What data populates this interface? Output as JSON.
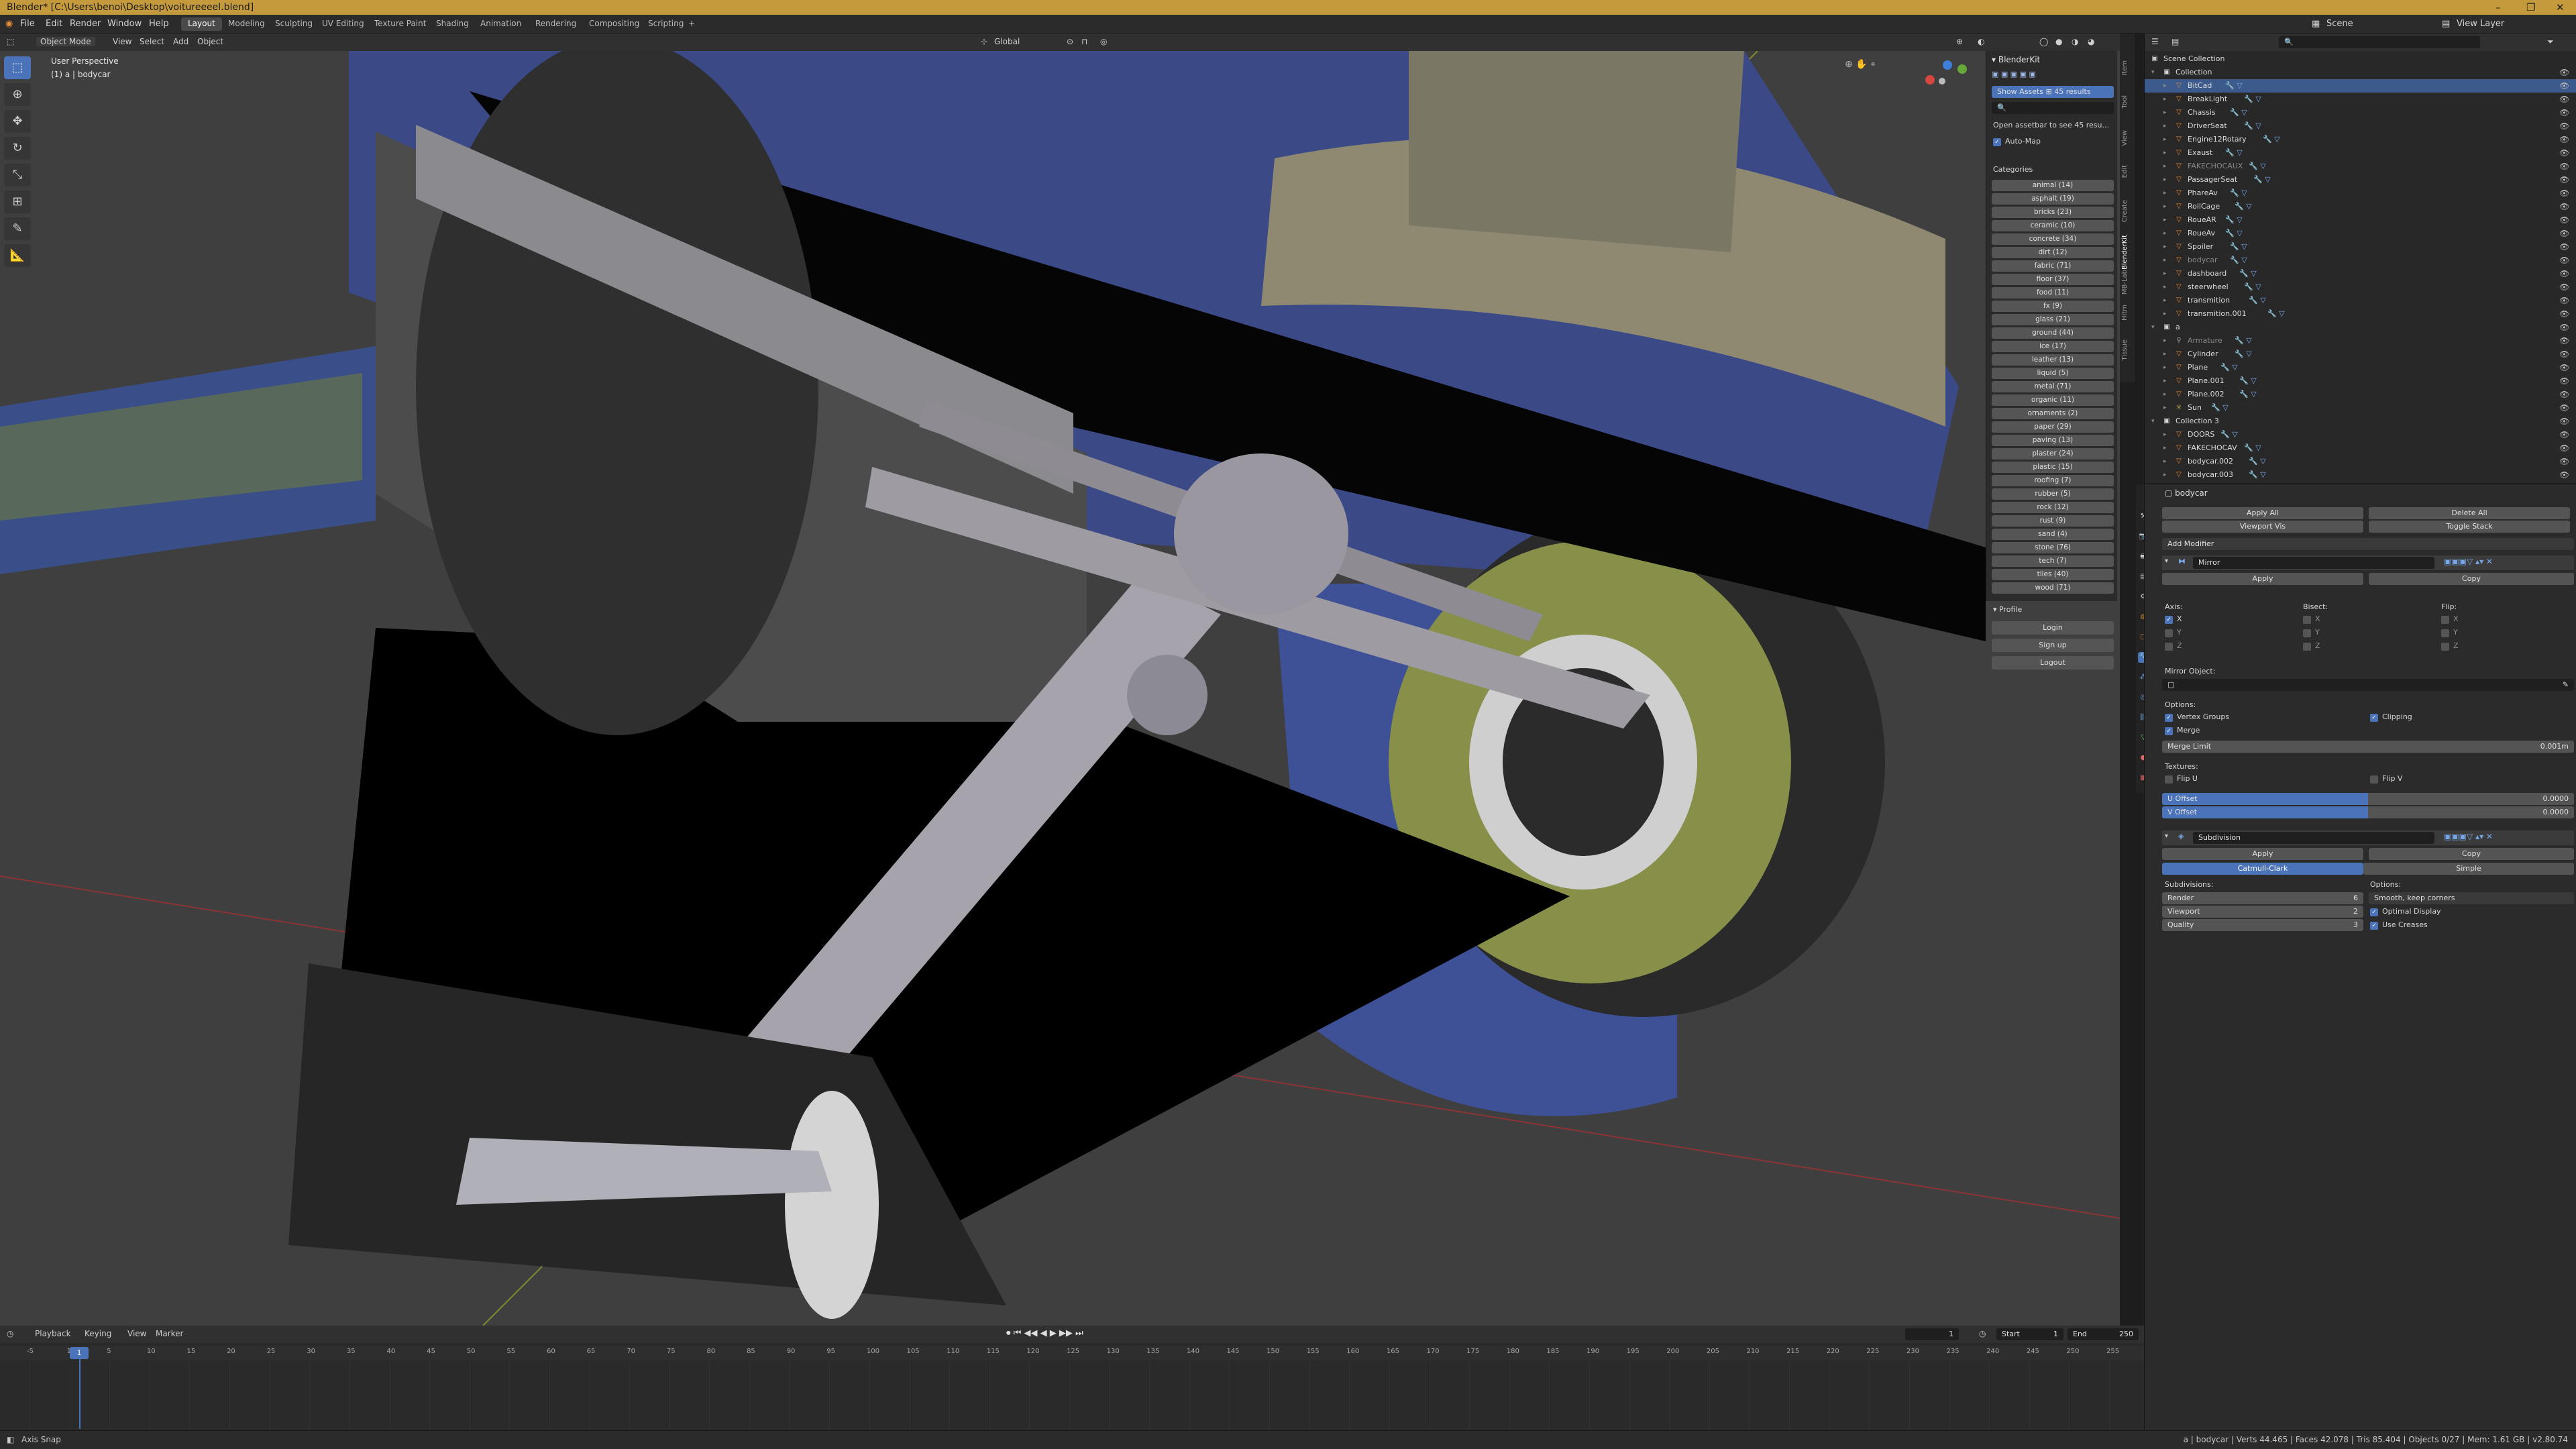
{
  "window": {
    "title": "Blender* [C:\\Users\\benoi\\Desktop\\voitureeeel.blend]",
    "controls": [
      "–",
      "❐",
      "✕"
    ]
  },
  "menu": [
    "File",
    "Edit",
    "Render",
    "Window",
    "Help"
  ],
  "workspaces": {
    "active": "Layout",
    "tabs": [
      "Layout",
      "Modeling",
      "Sculpting",
      "UV Editing",
      "Texture Paint",
      "Shading",
      "Animation",
      "Rendering",
      "Compositing",
      "Scripting",
      "+"
    ]
  },
  "scene": {
    "label": "Scene",
    "view_layer": "View Layer"
  },
  "viewport_header": {
    "mode": "Object Mode",
    "menus": [
      "View",
      "Select",
      "Add",
      "Object"
    ],
    "orientation": "Global"
  },
  "viewport": {
    "perspective": "User Perspective",
    "object_info": "(1) a | bodycar"
  },
  "blenderkit": {
    "title": "BlenderKit",
    "show_assets": "Show Assets",
    "results": "45 results",
    "open_hint": "Open assetbar to see 45 resu...",
    "auto_map": "Auto-Map",
    "categories_title": "Categories",
    "categories": [
      "animal (14)",
      "asphalt (19)",
      "bricks (23)",
      "ceramic (10)",
      "concrete (34)",
      "dirt (12)",
      "fabric (71)",
      "floor (37)",
      "food (11)",
      "fx (9)",
      "glass (21)",
      "ground (44)",
      "ice (17)",
      "leather (13)",
      "liquid (5)",
      "metal (71)",
      "organic (11)",
      "ornaments (2)",
      "paper (29)",
      "paving (13)",
      "plaster (24)",
      "plastic (15)",
      "roofing (7)",
      "rubber (5)",
      "rock (12)",
      "rust (9)",
      "sand (4)",
      "stone (76)",
      "tech (7)",
      "tiles (40)",
      "wood (71)"
    ],
    "profile_title": "Profile",
    "profile_buttons": [
      "Login",
      "Sign up",
      "Logout"
    ]
  },
  "side_tabs": [
    "Item",
    "Tool",
    "View",
    "Edit",
    "Create",
    "BlenderKit",
    "MB-Lab",
    "Hitm",
    "Tissue"
  ],
  "outliner": {
    "root": "Scene Collection",
    "rows": [
      {
        "indent": 1,
        "name": "Collection",
        "kind": "collection"
      },
      {
        "indent": 2,
        "name": "BitCad",
        "kind": "object",
        "selected": true
      },
      {
        "indent": 2,
        "name": "BreakLight",
        "kind": "object"
      },
      {
        "indent": 2,
        "name": "Chassis",
        "kind": "object"
      },
      {
        "indent": 2,
        "name": "DriverSeat",
        "kind": "object"
      },
      {
        "indent": 2,
        "name": "Engine12Rotary",
        "kind": "object"
      },
      {
        "indent": 2,
        "name": "Exaust",
        "kind": "object"
      },
      {
        "indent": 2,
        "name": "FAKECHOCAUX",
        "kind": "object",
        "dim": true
      },
      {
        "indent": 2,
        "name": "PassagerSeat",
        "kind": "object"
      },
      {
        "indent": 2,
        "name": "PhareAv",
        "kind": "object"
      },
      {
        "indent": 2,
        "name": "RollCage",
        "kind": "object"
      },
      {
        "indent": 2,
        "name": "RoueAR",
        "kind": "object"
      },
      {
        "indent": 2,
        "name": "RoueAv",
        "kind": "object"
      },
      {
        "indent": 2,
        "name": "Spoiler",
        "kind": "object"
      },
      {
        "indent": 2,
        "name": "bodycar",
        "kind": "object",
        "dim": true
      },
      {
        "indent": 2,
        "name": "dashboard",
        "kind": "object"
      },
      {
        "indent": 2,
        "name": "steerwheel",
        "kind": "object"
      },
      {
        "indent": 2,
        "name": "transmition",
        "kind": "object"
      },
      {
        "indent": 2,
        "name": "transmition.001",
        "kind": "object"
      },
      {
        "indent": 1,
        "name": "a",
        "kind": "collection"
      },
      {
        "indent": 2,
        "name": "Armature",
        "kind": "armature",
        "dim": true
      },
      {
        "indent": 2,
        "name": "Cylinder",
        "kind": "object"
      },
      {
        "indent": 2,
        "name": "Plane",
        "kind": "object"
      },
      {
        "indent": 2,
        "name": "Plane.001",
        "kind": "object"
      },
      {
        "indent": 2,
        "name": "Plane.002",
        "kind": "object"
      },
      {
        "indent": 2,
        "name": "Sun",
        "kind": "light"
      },
      {
        "indent": 1,
        "name": "Collection 3",
        "kind": "collection"
      },
      {
        "indent": 2,
        "name": "DOORS",
        "kind": "object"
      },
      {
        "indent": 2,
        "name": "FAKECHOCAV",
        "kind": "object"
      },
      {
        "indent": 2,
        "name": "bodycar.002",
        "kind": "object"
      },
      {
        "indent": 2,
        "name": "bodycar.003",
        "kind": "object"
      }
    ]
  },
  "properties": {
    "object": "bodycar",
    "apply_all": "Apply All",
    "delete_all": "Delete All",
    "viewport_vis": "Viewport Vis",
    "toggle_stack": "Toggle Stack",
    "add_modifier": "Add Modifier",
    "mirror": {
      "name": "Mirror",
      "apply": "Apply",
      "copy": "Copy",
      "axis_label": "Axis:",
      "bisect_label": "Bisect:",
      "flip_label": "Flip:",
      "axes": [
        "X",
        "Y",
        "Z"
      ],
      "mirror_object": "Mirror Object:",
      "options_label": "Options:",
      "vertex_groups": "Vertex Groups",
      "clipping": "Clipping",
      "merge": "Merge",
      "merge_limit_label": "Merge Limit",
      "merge_limit_value": "0.001m",
      "textures_label": "Textures:",
      "flip_u": "Flip U",
      "flip_v": "Flip V",
      "u_offset_label": "U Offset",
      "u_offset_value": "0.0000",
      "v_offset_label": "V Offset",
      "v_offset_value": "0.0000"
    },
    "subdivision": {
      "name": "Subdivision",
      "apply": "Apply",
      "copy": "Copy",
      "catmull": "Catmull-Clark",
      "simple": "Simple",
      "subdivisions_label": "Subdivisions:",
      "options_label": "Options:",
      "render_label": "Render",
      "render_value": "6",
      "viewport_label": "Viewport",
      "viewport_value": "2",
      "quality_label": "Quality",
      "quality_value": "3",
      "smooth": "Smooth, keep corners",
      "optimal_display": "Optimal Display",
      "use_creases": "Use Creases"
    }
  },
  "timeline": {
    "menus": [
      "Playback",
      "Keying",
      "View",
      "Marker"
    ],
    "current_frame": "1",
    "start_label": "Start",
    "start_value": "1",
    "end_label": "End",
    "end_value": "250",
    "ticks": [
      "-5",
      "1",
      "5",
      "10",
      "15",
      "20",
      "25",
      "30",
      "35",
      "40",
      "45",
      "50",
      "55",
      "60",
      "65",
      "70",
      "75",
      "80",
      "85",
      "90",
      "95",
      "100",
      "105",
      "110",
      "115",
      "120",
      "125",
      "130",
      "135",
      "140",
      "145",
      "150",
      "155",
      "160",
      "165",
      "170",
      "175",
      "180",
      "185",
      "190",
      "195",
      "200",
      "205",
      "210",
      "215",
      "220",
      "225",
      "230",
      "235",
      "240",
      "245",
      "250",
      "255"
    ]
  },
  "status": {
    "left": "Axis Snap",
    "right": "a | bodycar | Verts 44.465 | Faces 42.078 | Tris 85.404 | Objects 0/27 | Mem: 1.61 GB | v2.80.74"
  },
  "colors": {
    "accent": "#4b73b9",
    "titlebar": "#c49a3c",
    "object_icon": "#e88b35",
    "modifier_icon": "#78a7e8"
  }
}
